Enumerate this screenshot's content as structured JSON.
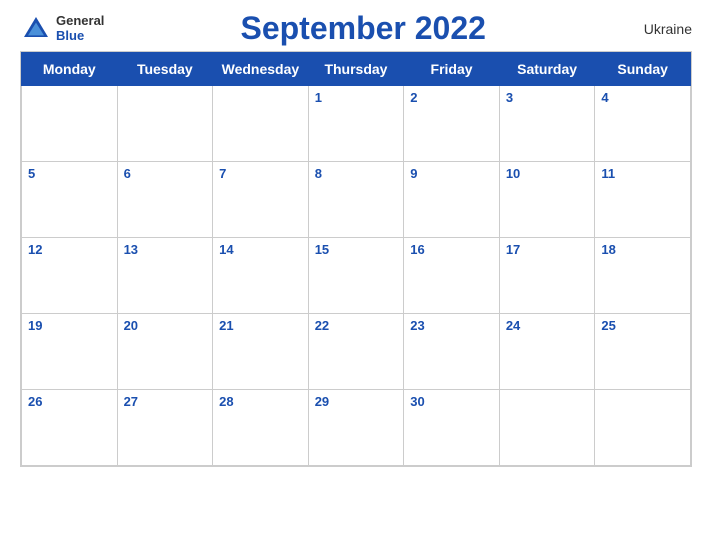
{
  "logo": {
    "general": "General",
    "blue": "Blue"
  },
  "title": "September 2022",
  "country": "Ukraine",
  "weekdays": [
    "Monday",
    "Tuesday",
    "Wednesday",
    "Thursday",
    "Friday",
    "Saturday",
    "Sunday"
  ],
  "weeks": [
    [
      null,
      null,
      null,
      1,
      2,
      3,
      4
    ],
    [
      5,
      6,
      7,
      8,
      9,
      10,
      11
    ],
    [
      12,
      13,
      14,
      15,
      16,
      17,
      18
    ],
    [
      19,
      20,
      21,
      22,
      23,
      24,
      25
    ],
    [
      26,
      27,
      28,
      29,
      30,
      null,
      null
    ]
  ]
}
